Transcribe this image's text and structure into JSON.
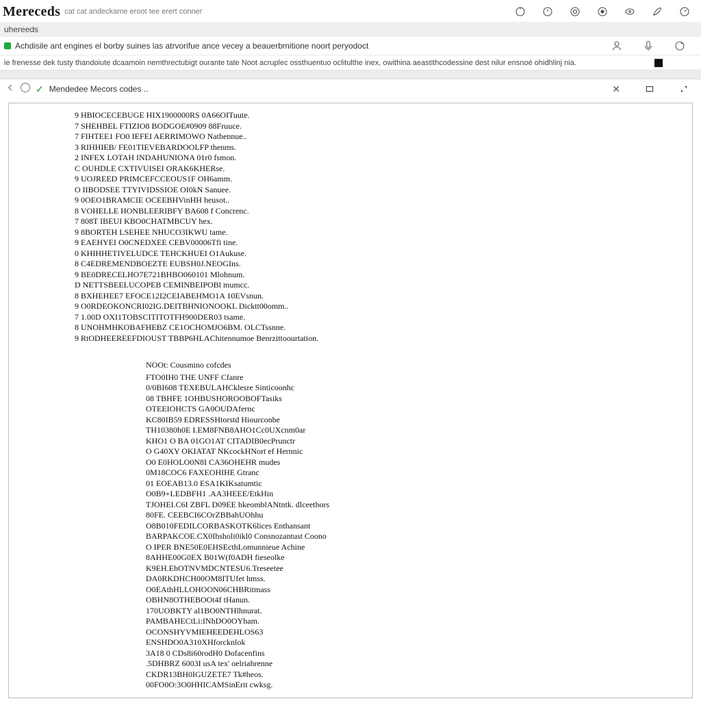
{
  "top": {
    "brand": "Mereceds",
    "brand_sub": "cat cat andeckame eroot tee erert conner"
  },
  "subbar": {
    "label": "uhereeds"
  },
  "prompt": {
    "text": "Achdisile ant engines el borby suines las atrvorifue ance vecey a beauerbmitione noort peryodoct"
  },
  "info": {
    "text": "ie frenesse dek tusty thandoiute dcaamoin nemthrectubigt ourante tate Noot acruplec ossthuentuo oclitulthe inex, owithina aeastithcodessine dest nilur ensnoé ohidhlinj nia."
  },
  "tab": {
    "title": "Mendedee Mecors codes .."
  },
  "codes_main": [
    "9 HBIOCECEBUGE HIX1900000RS 0A66OITuute.",
    "7 SHEHBEL FTIZIO8 BODGOE#0909 88Fruuce.",
    "7 FIHTEE1 FO0 IEFEI AERRIMOWO Nathennue..",
    "3 RIHHIEB/ FE01TIEVEBARDOOLFP thenms.",
    "2 INFEX LOTAH INDAHUNIONA 01r0 fsmon.",
    "C OUHDLE CXTIVUISEI ORAK6KHERse.",
    "9 UOJREED PRIMCEFCCEOUS1F OH6amm.",
    "O IIBODSEE TTYIVIDSSIOE OI0kN Sanuee.",
    "9 0OEO1BRAMCIE OCEEBHVinHH heusot..",
    "8 VOHELLE HONBLEERIBFY BA608 f Concrenc.",
    "7 808T IBEUI KBO0CHATMBCUY hex.",
    "9 8BORTEH LSEHEE NHUCO3IKWU tame.",
    "9 EAEHYEI O0CNEDXEE CEBV00006Tfi tine.",
    "0 KHIHHETIYELUDCE TEHCKHUEI O1Aukuse.",
    "8 C4EDREMENDBOEZTE EUBSH0J.NEOGIns.",
    "9 BE0DRECELHO7E721BHBO060101 Mlohnum.",
    "D NETTSBEELUCOPEB CEMINBEIPOBl mumcc.",
    "8 BXHEHEE7 EFOCE12I2CEIABEHMO1A 10EVsnun.",
    "9 O0RDEOKONCRI02IG.DEITBHNIONOOKL Dicktt00omm..",
    "7 1.00D OXI1TOBSCITITOTFH900DER03 tsame.",
    "8 UNOHMHKOBAFHEBZ CE1OCHOMJO6BM. OLCTssnne.",
    "9 RtODHEEREEFDIOUST TBBP6HLAChitennumoe Benrzittoourtation."
  ],
  "codes_secondary": [
    "NOOt: Cousmino cofcdes",
    "FTO0IH0 THE UNFF Cfanre",
    "0/0BI608 TEXEBULAHCklesre Sinticoonhc",
    "08 TBHFE 1OHBUSHOROOBOFTasiks",
    "OTEEIOHCTS GA0OUDAfernc",
    "KC80IB59 EDRESSHtorstd Hiourconbe",
    "TH10380h0E I.EM8FNB8AHO1Cc0UXcnm0ar",
    "KHO1 O BA 01GO1AT CITADIB0ecPrunctr",
    "O G40XY OKIATAT NKcockHNort ef Hernnic",
    "O0 E0HOLO0N8I CA36OHEHR mudes",
    "0M18COC6 FAXEOHIHE Gtranc",
    "01 EOEAB13.0 ESA1KIKsatumtic",
    "O0B9+LEDBFH1 .AA3HEEE/EtkHin",
    "TJOHEI.C6I ZBFL D09EE hkeomblANtntk. dlceethors",
    "80FE. CEEBCI6COrZBBahUOhhu",
    "O8B010FEDILCORBASKOTK6lices Enthansant",
    "BARPAKCOE.CX0Ihsholi0ikl0 Consnozantust Coono",
    "O IPER BNE50E0EHSEcthLomunnieue Achine",
    "8AHHE00G0EX B01W(f0ADH fieseolke",
    "K9EH.EhOTNVMDCNTESU6.Treseetee",
    "DA0RKDHCH00OM8ITUfet hmss.",
    "O0EAthHLLOHOON06CHBRitmass",
    "OBHN8OTHEBOOt4f tHanun.",
    "170UOBKTY al1BO0NTHlhnurat.",
    "PAMBAHECtLi:INhDO0OYham.",
    "OCONSHYVMIEHEEDEHLOS63",
    "ENSHDO0A310XHforcknlok",
    "3A18 0 CDs8i60rodH0 Dofacenfins",
    ".5DHBRZ 6003I usA tex' oelriahrenne",
    "CKDR13BH0IGUZETE7 Tk#heos.",
    "00FO0O:3O0HHICAMSinErit cwksg."
  ]
}
